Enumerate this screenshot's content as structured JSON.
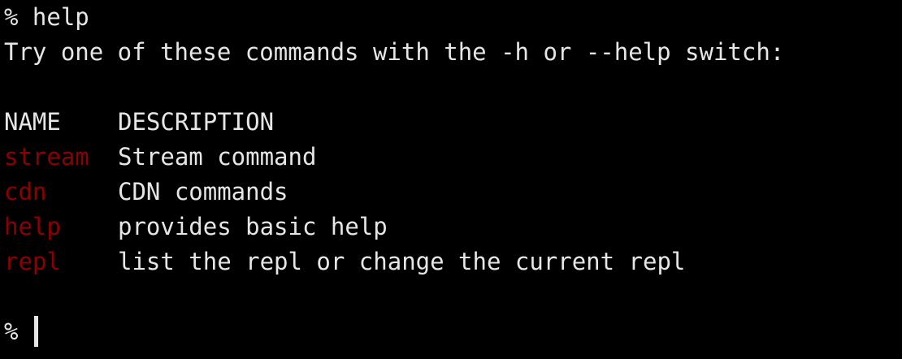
{
  "colors": {
    "background": "#000000",
    "text": "#e6e6e6",
    "command_name": "#8b0000"
  },
  "session": {
    "prompt_line": "% help",
    "intro_line": "Try one of these commands with the -h or --help switch:",
    "table": {
      "headers": [
        "NAME",
        "DESCRIPTION"
      ],
      "rows": [
        {
          "name": "stream",
          "description": "Stream command"
        },
        {
          "name": "cdn",
          "description": "CDN commands"
        },
        {
          "name": "help",
          "description": "provides basic help"
        },
        {
          "name": "repl",
          "description": "list the repl or change the current repl"
        }
      ]
    },
    "final_prompt": "% "
  }
}
